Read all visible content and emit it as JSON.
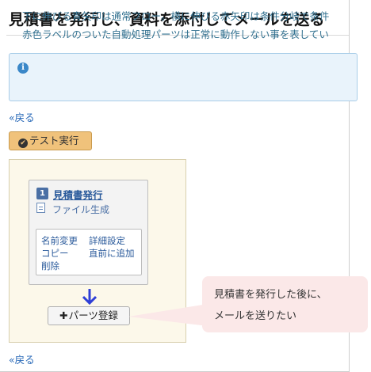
{
  "page": {
    "title": "見積書を発行し、資料を添付してメールを送る"
  },
  "info": {
    "icon": "info-icon",
    "line1": "下に伸びる青矢印は通常フロー。横に伸びる赤矢印は条件分岐で条件",
    "line2": "赤色ラベルのついた自動処理パーツは正常に動作しない事を表してい"
  },
  "nav": {
    "back_top": "«戻る",
    "back_bottom": "«戻る"
  },
  "test_button": {
    "label": "テスト実行",
    "icon": "check-circle-icon"
  },
  "part": {
    "number": "1",
    "title": "見積書発行",
    "subtitle": "ファイル生成",
    "icon": "document-icon",
    "menu": {
      "rename": "名前変更",
      "detail": "詳細設定",
      "copy": "コピー",
      "insert_before": "直前に追加",
      "delete": "削除"
    }
  },
  "flow": {
    "arrow_icon": "arrow-down-icon",
    "arrow_color": "#2f3fd6",
    "add_button": "パーツ登録",
    "add_icon": "plus-icon"
  },
  "callout": {
    "line1": "見積書を発行した後に、",
    "line2": "メールを送りたい"
  }
}
